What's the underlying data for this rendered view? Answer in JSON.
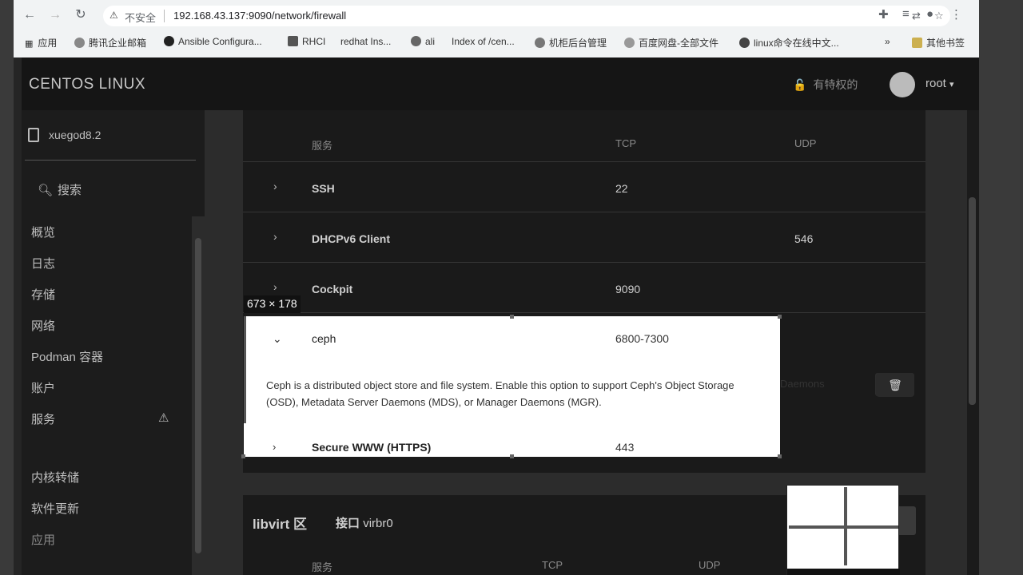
{
  "browser": {
    "url": "192.168.43.137:9090/network/firewall",
    "security_label": "不安全",
    "bookmarks": [
      {
        "label": "应用"
      },
      {
        "label": "腾讯企业邮箱"
      },
      {
        "label": "Ansible Configura..."
      },
      {
        "label": "RHCI"
      },
      {
        "label": "redhat Ins..."
      },
      {
        "label": "ali"
      },
      {
        "label": "Index of /cen..."
      },
      {
        "label": "机柜后台管理"
      },
      {
        "label": "百度网盘-全部文件"
      },
      {
        "label": "linux命令在线中文..."
      },
      {
        "label": "其他书签"
      }
    ],
    "more_bookmarks": "»"
  },
  "masthead": {
    "brand": "CENTOS LINUX",
    "privileged": "有特权的",
    "user": "root"
  },
  "sidebar": {
    "host": "xuegod8.2",
    "search": "搜索",
    "items": [
      {
        "label": "概览"
      },
      {
        "label": "日志"
      },
      {
        "label": "存储"
      },
      {
        "label": "网络"
      },
      {
        "label": "Podman 容器"
      },
      {
        "label": "账户"
      },
      {
        "label": "服务"
      },
      {
        "label": "内核转储"
      },
      {
        "label": "软件更新"
      },
      {
        "label": "应用"
      }
    ]
  },
  "firewall": {
    "columns": {
      "service": "服务",
      "tcp": "TCP",
      "udp": "UDP"
    },
    "services": [
      {
        "name": "SSH",
        "tcp": "22",
        "udp": ""
      },
      {
        "name": "DHCPv6 Client",
        "tcp": "",
        "udp": "546"
      },
      {
        "name": "Cockpit",
        "tcp": "9090",
        "udp": ""
      },
      {
        "name": "ceph",
        "tcp": "6800-7300",
        "udp": ""
      },
      {
        "name": "Secure WWW (HTTPS)",
        "tcp": "443",
        "udp": ""
      }
    ],
    "ceph_description_inside": "Ceph is a distributed object store and file system. Enable this option to support Ceph's Object Storage",
    "ceph_description_outside": "Daemons",
    "ceph_description_line2": "(OSD), Metadata Server Daemons (MDS), or Manager Daemons (MGR).",
    "zone2": {
      "title": "libvirt 区",
      "iface_label": "接口",
      "iface_name": "virbr0",
      "columns": {
        "service": "服务",
        "tcp": "TCP",
        "udp": "UDP"
      }
    }
  },
  "capture": {
    "size_label": "673 × 178"
  }
}
